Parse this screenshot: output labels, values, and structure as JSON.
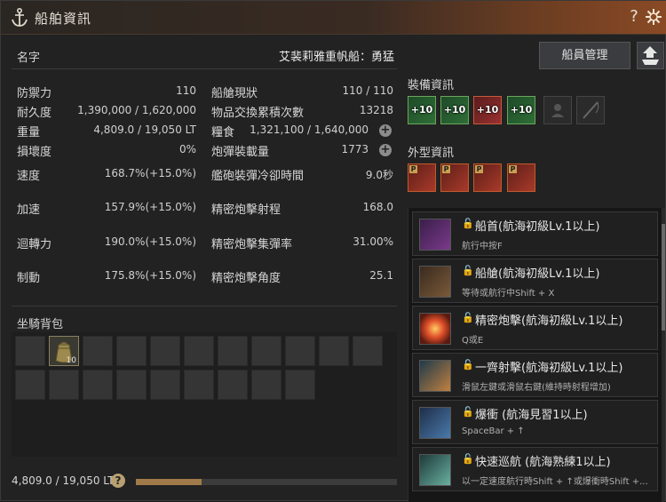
{
  "window": {
    "title": "船舶資訊"
  },
  "info": {
    "name_label": "名字",
    "ship_name": "艾裴莉雅重帆船：勇猛",
    "stats_left": [
      {
        "label": "防禦力",
        "value": "110"
      },
      {
        "label": "耐久度",
        "value": "1,390,000 / 1,620,000"
      },
      {
        "label": "重量",
        "value": "4,809.0 / 19,050 LT"
      },
      {
        "label": "損壞度",
        "value": "0%"
      }
    ],
    "stats_right": [
      {
        "label": "船艙現狀",
        "value": "110 / 110"
      },
      {
        "label": "物品交換累積次數",
        "value": "13218"
      },
      {
        "label": "糧食",
        "value": "1,321,100 / 1,640,000"
      },
      {
        "label": "炮彈裝載量",
        "value": "1773"
      }
    ],
    "perf_left": [
      {
        "label": "速度",
        "value": "168.7%(+15.0%)"
      },
      {
        "label": "加速",
        "value": "157.9%(+15.0%)"
      },
      {
        "label": "迴轉力",
        "value": "190.0%(+15.0%)"
      },
      {
        "label": "制動",
        "value": "175.8%(+15.0%)"
      }
    ],
    "perf_right": [
      {
        "label": "艦砲裝彈冷卻時間",
        "value": "9.0秒"
      },
      {
        "label": "精密炮擊射程",
        "value": "168.0"
      },
      {
        "label": "精密炮擊集彈率",
        "value": "31.00%"
      },
      {
        "label": "精密炮擊角度",
        "value": "25.1"
      }
    ]
  },
  "bag": {
    "title": "坐騎背包",
    "item_count": "10",
    "weight_text": "4,809.0 / 19,050 LT",
    "weight_fraction": 0.2524
  },
  "right": {
    "crew_button": "船員管理",
    "equip_title": "裝備資訊",
    "equip_enhance": [
      "+10",
      "+10",
      "+10",
      "+10"
    ],
    "outer_title": "外型資訊",
    "outer_tag": "P"
  },
  "skills": [
    {
      "name": "船首(航海初級Lv.1以上)",
      "key": "航行中按F"
    },
    {
      "name": "船艙(航海初級Lv.1以上)",
      "key": "等待或航行中Shift + X"
    },
    {
      "name": "精密炮擊(航海初級Lv.1以上)",
      "key": "Q或E"
    },
    {
      "name": "一齊射擊(航海初級Lv.1以上)",
      "key": "滑鼠左鍵或滑鼠右鍵(維持時射程增加)"
    },
    {
      "name": "爆衝 (航海見習1以上)",
      "key": "SpaceBar + ↑"
    },
    {
      "name": "快速巡航 (航海熟練1以上)",
      "key": "以一定速度航行時Shift + ↑或爆衝時Shift +..."
    }
  ],
  "colors": {
    "accent": "#a07a48",
    "title_bar": "#8a4a25"
  }
}
